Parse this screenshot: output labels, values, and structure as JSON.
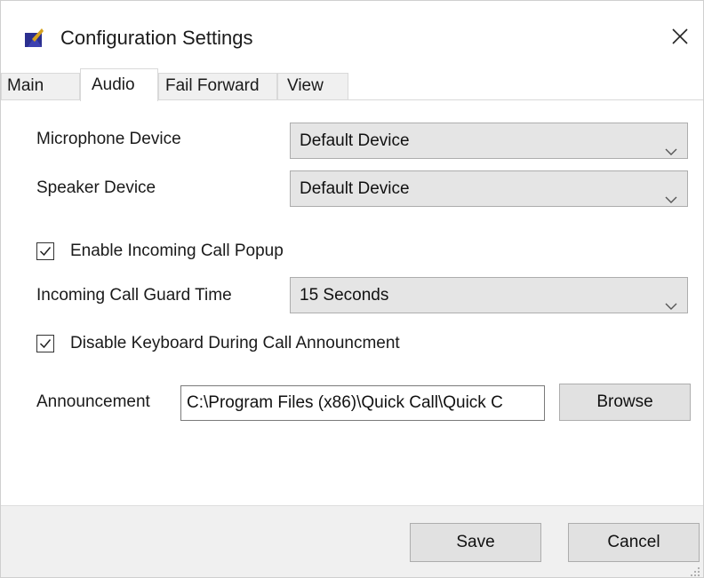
{
  "window": {
    "title": "Configuration Settings",
    "close_glyph": "✕",
    "icon": "app-logo-icon"
  },
  "tabs": [
    {
      "label": "Main",
      "active": false
    },
    {
      "label": "Audio",
      "active": true
    },
    {
      "label": "Fail Forward",
      "active": false
    },
    {
      "label": "View",
      "active": false
    }
  ],
  "audio": {
    "microphone": {
      "label": "Microphone Device",
      "value": "Default Device"
    },
    "speaker": {
      "label": "Speaker Device",
      "value": "Default Device"
    },
    "enable_popup": {
      "label": "Enable Incoming Call Popup",
      "checked": true
    },
    "guard_time": {
      "label": "Incoming Call Guard Time",
      "value": "15 Seconds"
    },
    "disable_keyboard": {
      "label": "Disable Keyboard During Call Announcment",
      "checked": true
    },
    "announcement": {
      "label": "Announcement",
      "value": "C:\\Program Files (x86)\\Quick Call\\Quick C",
      "browse_label": "Browse"
    }
  },
  "footer": {
    "save_label": "Save",
    "cancel_label": "Cancel"
  },
  "colors": {
    "app_icon_blue": "#2b2f8f",
    "app_icon_gold": "#d6a21e",
    "combo_bg": "#e5e5e5",
    "button_bg": "#e1e1e1",
    "footer_bg": "#f0f0f0"
  }
}
